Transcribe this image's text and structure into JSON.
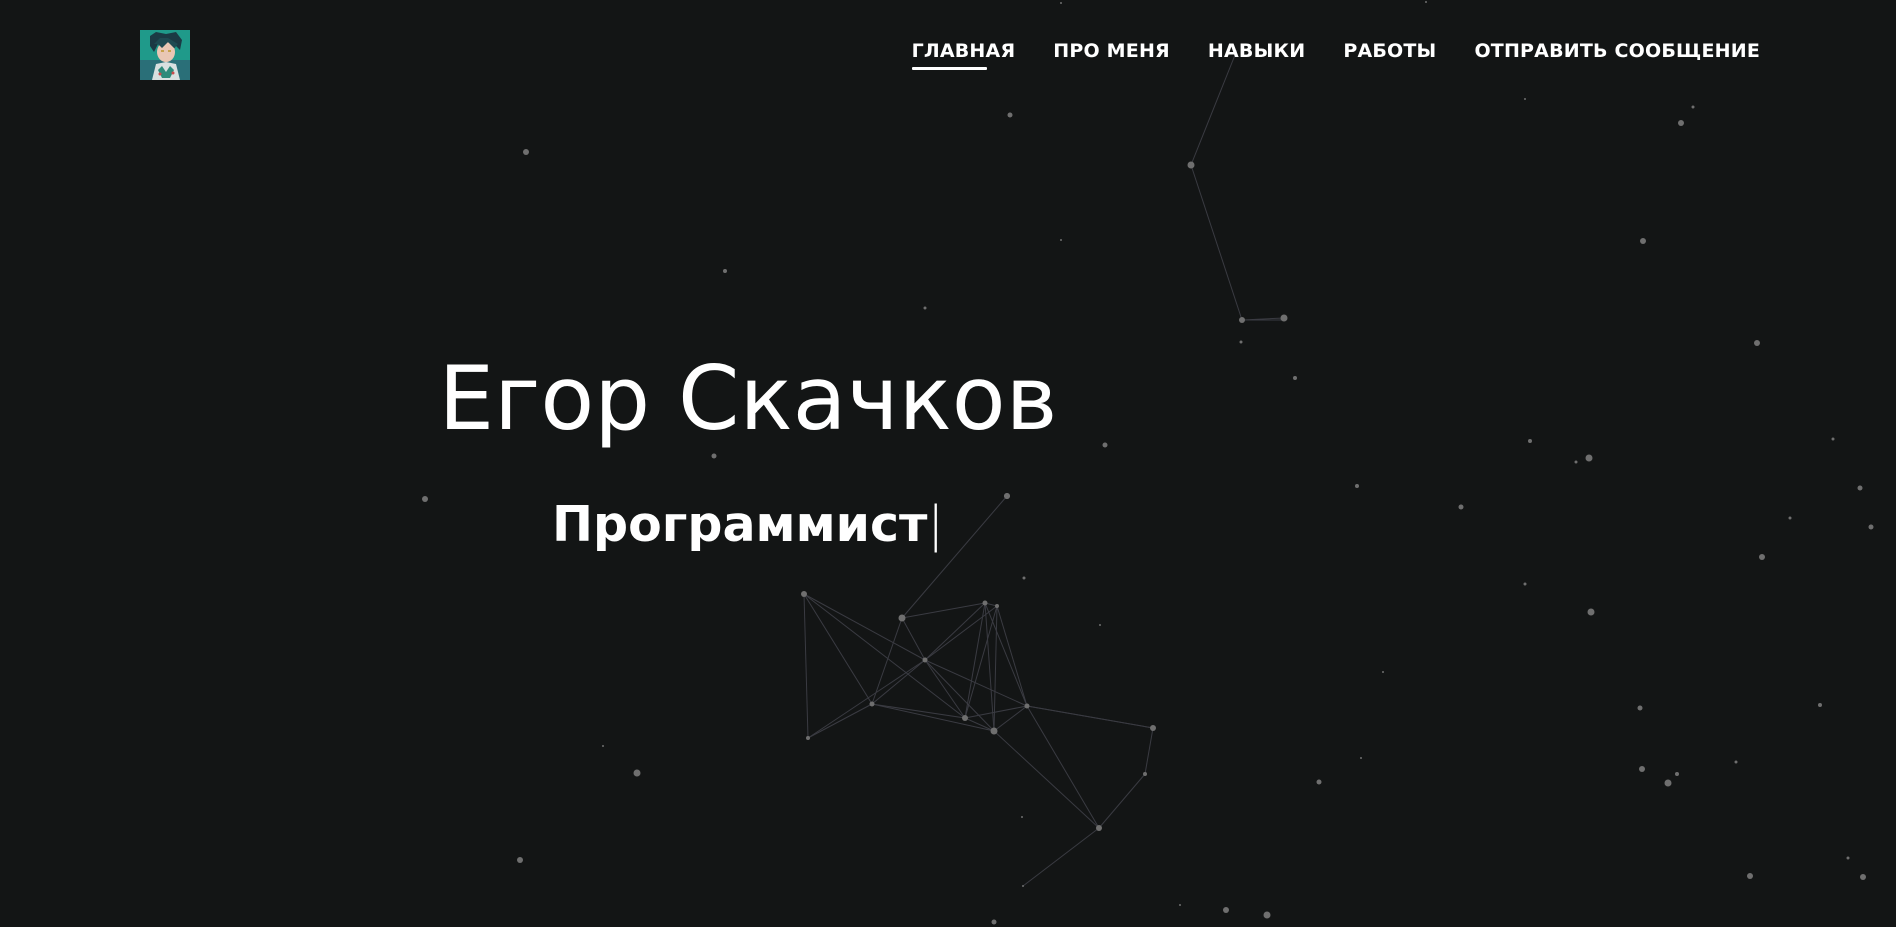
{
  "nav": {
    "items": [
      {
        "label": "ГЛАВНАЯ",
        "active": true
      },
      {
        "label": "ПРО МЕНЯ",
        "active": false
      },
      {
        "label": "НАВЫКИ",
        "active": false
      },
      {
        "label": "РАБОТЫ",
        "active": false
      },
      {
        "label": "ОТПРАВИТЬ СООБЩЕНИЕ",
        "active": false
      }
    ]
  },
  "hero": {
    "name": "Егор Скачков",
    "subtitle": "Программист",
    "cursor": "|"
  },
  "colors": {
    "background": "#131515",
    "text": "#ffffff",
    "particle": "#6f6f6f",
    "link": "#3a3b42",
    "logo_bg": "#1f9a8a"
  },
  "icons": {
    "logo": "avatar-logo"
  }
}
